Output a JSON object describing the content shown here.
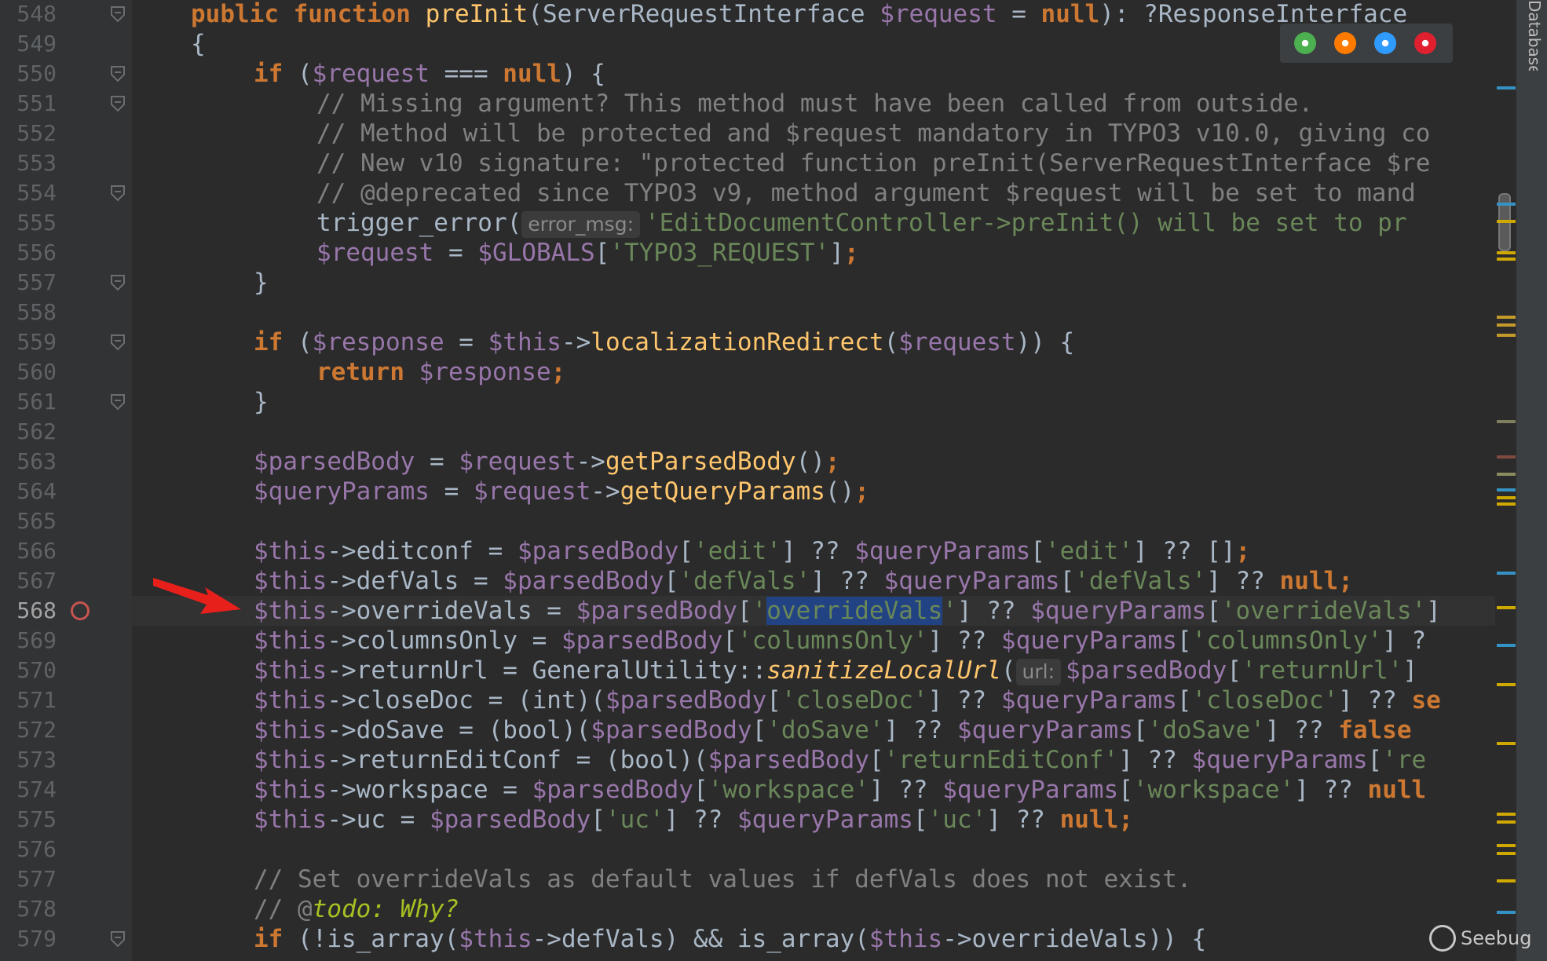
{
  "tool_window": {
    "label": "Database"
  },
  "browsers": [
    {
      "name": "chrome-icon",
      "color": "#4caf50"
    },
    {
      "name": "firefox-icon",
      "color": "#ff7b00"
    },
    {
      "name": "safari-icon",
      "color": "#2f9bff"
    },
    {
      "name": "opera-icon",
      "color": "#e0202e"
    }
  ],
  "watermark": {
    "text": "Seebug"
  },
  "line_numbers": [
    "548",
    "549",
    "550",
    "551",
    "552",
    "553",
    "554",
    "555",
    "556",
    "557",
    "558",
    "559",
    "560",
    "561",
    "562",
    "563",
    "564",
    "565",
    "566",
    "567",
    "568",
    "569",
    "570",
    "571",
    "572",
    "573",
    "574",
    "575",
    "576",
    "577",
    "578",
    "579"
  ],
  "current_line": "568",
  "code": {
    "l548": {
      "t1": "public function ",
      "fn": "preInit",
      "t2": "(ServerRequestInterface ",
      "v": "$request",
      "t3": " = ",
      "k": "null",
      "t4": "): ?ResponseInterface"
    },
    "l549": {
      "t1": "{"
    },
    "l550": {
      "k": "if",
      "t1": " (",
      "v": "$request",
      "t2": " === ",
      "k2": "null",
      "t3": ") {"
    },
    "l551": {
      "c": "// Missing argument? This method must have been called from outside."
    },
    "l552": {
      "c": "// Method will be protected and $request mandatory in TYPO3 v10.0, giving co"
    },
    "l553": {
      "c": "// New v10 signature: \"protected function preInit(ServerRequestInterface $re"
    },
    "l554": {
      "c": "// @deprecated since TYPO3 v9, method argument $request will be set to mand"
    },
    "l555": {
      "t1": "trigger_error(",
      "hint": "error_msg:",
      "s": "'EditDocumentController->preInit() will be set to pr"
    },
    "l556": {
      "v": "$request",
      "t1": " = ",
      "v2": "$GLOBALS",
      "t2": "[",
      "s": "'TYPO3_REQUEST'",
      "t3": "]",
      "k": ";"
    },
    "l557": {
      "t1": "}"
    },
    "l559": {
      "k": "if",
      "t1": " (",
      "v": "$response",
      "t2": " = ",
      "v2": "$this",
      "t3": "->",
      "fn": "localizationRedirect",
      "t4": "(",
      "v3": "$request",
      "t5": ")) {"
    },
    "l560": {
      "k": "return ",
      "v": "$response",
      "k2": ";"
    },
    "l561": {
      "t1": "}"
    },
    "l563": {
      "v": "$parsedBody",
      "t1": " = ",
      "v2": "$request",
      "t2": "->",
      "fn": "getParsedBody",
      "t3": "()",
      "k": ";"
    },
    "l564": {
      "v": "$queryParams",
      "t1": " = ",
      "v2": "$request",
      "t2": "->",
      "fn": "getQueryParams",
      "t3": "()",
      "k": ";"
    },
    "l566": {
      "v": "$this",
      "t1": "->editconf = ",
      "v2": "$parsedBody",
      "t2": "[",
      "s": "'edit'",
      "t3": "] ?? ",
      "v3": "$queryParams",
      "t4": "[",
      "s2": "'edit'",
      "t5": "] ?? []",
      "k": ";"
    },
    "l567": {
      "v": "$this",
      "t1": "->defVals = ",
      "v2": "$parsedBody",
      "t2": "[",
      "s": "'defVals'",
      "t3": "] ?? ",
      "v3": "$queryParams",
      "t4": "[",
      "s2": "'defVals'",
      "t5": "] ?? ",
      "k": "null;"
    },
    "l568": {
      "v": "$this",
      "t1": "->overrideVals = ",
      "v2": "$parsedBody",
      "t2": "[",
      "q1": "'",
      "sel": "overrideVals",
      "q2": "'",
      "t3": "] ?? ",
      "v3": "$queryParams",
      "t4": "[",
      "s2": "'overrideVals'",
      "t5": "]"
    },
    "l569": {
      "v": "$this",
      "t1": "->columnsOnly = ",
      "v2": "$parsedBody",
      "t2": "[",
      "s": "'columnsOnly'",
      "t3": "] ?? ",
      "v3": "$queryParams",
      "t4": "[",
      "s2": "'columnsOnly'",
      "t5": "] ?"
    },
    "l570": {
      "v": "$this",
      "t1": "->returnUrl = GeneralUtility::",
      "fn": "sanitizeLocalUrl",
      "t2": "(",
      "hint": "url:",
      "v2": "$parsedBody",
      "t3": "[",
      "s": "'returnUrl'",
      "t4": "]"
    },
    "l571": {
      "v": "$this",
      "t1": "->closeDoc = (int)(",
      "v2": "$parsedBody",
      "t2": "[",
      "s": "'closeDoc'",
      "t3": "] ?? ",
      "v3": "$queryParams",
      "t4": "[",
      "s2": "'closeDoc'",
      "t5": "] ?? ",
      "k": "se"
    },
    "l572": {
      "v": "$this",
      "t1": "->doSave = (bool)(",
      "v2": "$parsedBody",
      "t2": "[",
      "s": "'doSave'",
      "t3": "] ?? ",
      "v3": "$queryParams",
      "t4": "[",
      "s2": "'doSave'",
      "t5": "] ?? ",
      "k": "false"
    },
    "l573": {
      "v": "$this",
      "t1": "->returnEditConf = (bool)(",
      "v2": "$parsedBody",
      "t2": "[",
      "s": "'returnEditConf'",
      "t3": "] ?? ",
      "v3": "$queryParams",
      "t4": "[",
      "s2": "'re"
    },
    "l574": {
      "v": "$this",
      "t1": "->workspace = ",
      "v2": "$parsedBody",
      "t2": "[",
      "s": "'workspace'",
      "t3": "] ?? ",
      "v3": "$queryParams",
      "t4": "[",
      "s2": "'workspace'",
      "t5": "] ?? ",
      "k": "null"
    },
    "l575": {
      "v": "$this",
      "t1": "->uc = ",
      "v2": "$parsedBody",
      "t2": "[",
      "s": "'uc'",
      "t3": "] ?? ",
      "v3": "$queryParams",
      "t4": "[",
      "s2": "'uc'",
      "t5": "] ?? ",
      "k": "null;"
    },
    "l577": {
      "c": "// Set overrideVals as default values if defVals does not exist."
    },
    "l578": {
      "c": "// @",
      "todo": "todo: Why?"
    },
    "l579": {
      "k": "if",
      "t1": " (!is_array(",
      "v": "$this",
      "t2": "->defVals) && is_array(",
      "v2": "$this",
      "t3": "->overrideVals)) {"
    }
  }
}
